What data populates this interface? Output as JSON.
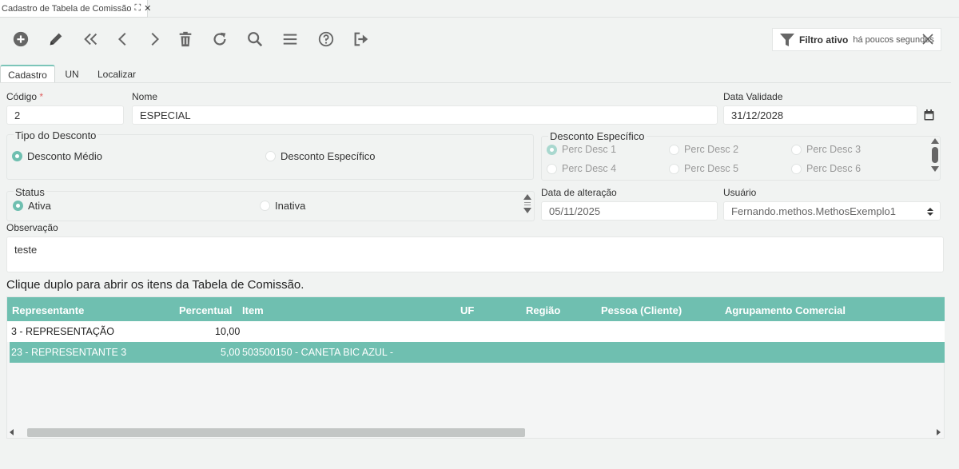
{
  "doc_tab": {
    "title": "Cadastro de Tabela de Comissão"
  },
  "filter": {
    "label": "Filtro ativo",
    "time": "há poucos segundos"
  },
  "tabs": [
    {
      "label": "Cadastro"
    },
    {
      "label": "UN"
    },
    {
      "label": "Localizar"
    }
  ],
  "form": {
    "codigo_label": "Código",
    "required_mark": "*",
    "codigo_value": "2",
    "nome_label": "Nome",
    "nome_value": "ESPECIAL",
    "data_validade_label": "Data Validade",
    "data_validade_value": "31/12/2028",
    "tipo_desconto_label": "Tipo do Desconto",
    "tipo_desconto_options": [
      {
        "label": "Desconto Médio",
        "selected": true
      },
      {
        "label": "Desconto Específico",
        "selected": false
      }
    ],
    "desconto_especifico_label": "Desconto Específico",
    "perc_options": [
      {
        "label": "Perc Desc 1",
        "selected": true
      },
      {
        "label": "Perc Desc 2",
        "selected": false
      },
      {
        "label": "Perc Desc 3",
        "selected": false
      },
      {
        "label": "Perc Desc 4",
        "selected": false
      },
      {
        "label": "Perc Desc 5",
        "selected": false
      },
      {
        "label": "Perc Desc 6",
        "selected": false
      }
    ],
    "status_label": "Status",
    "status_options": [
      {
        "label": "Ativa",
        "selected": true
      },
      {
        "label": "Inativa",
        "selected": false
      }
    ],
    "data_alteracao_label": "Data de alteração",
    "data_alteracao_value": "05/11/2025",
    "usuario_label": "Usuário",
    "usuario_value": "Fernando.methos.MethosExemplo1",
    "observacao_label": "Observação",
    "observacao_value": "teste"
  },
  "hint": "Clique duplo para abrir os itens da Tabela de Comissão.",
  "grid": {
    "columns": [
      "Representante",
      "Percentual",
      "Item",
      "UF",
      "Região",
      "Pessoa (Cliente)",
      "Agrupamento Comercial"
    ],
    "rows": [
      {
        "representante": "3 - REPRESENTAÇÃO",
        "percentual": "10,00",
        "item": "",
        "selected": false
      },
      {
        "representante": "23 - REPRESENTANTE 3",
        "percentual": "5,00",
        "item": "503500150 - CANETA BIC AZUL -",
        "selected": true
      }
    ]
  },
  "colors": {
    "accent": "#6fbfb0",
    "background": "#f1f3f2"
  }
}
